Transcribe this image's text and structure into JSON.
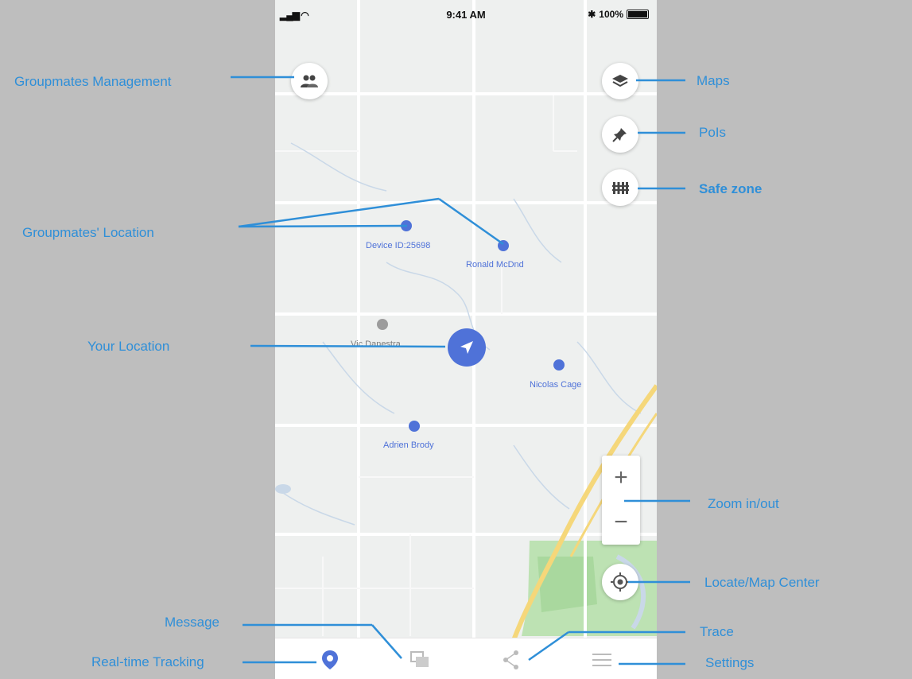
{
  "status_bar": {
    "time": "9:41 AM",
    "battery": "100%"
  },
  "annotations": {
    "groupmates_management": "Groupmates Management",
    "maps": "Maps",
    "pois": "PoIs",
    "safe_zone": "Safe zone",
    "groupmates_location": "Groupmates' Location",
    "your_location": "Your Location",
    "zoom": "Zoom in/out",
    "locate": "Locate/Map Center",
    "message": "Message",
    "trace": "Trace",
    "realtime": "Real-time Tracking",
    "settings": "Settings"
  },
  "markers": [
    {
      "label": "Device ID:25698"
    },
    {
      "label": "Ronald McDnd"
    },
    {
      "label": "Vic Danestra"
    },
    {
      "label": "Nicolas Cage"
    },
    {
      "label": "Adrien Brody"
    }
  ],
  "zoom": {
    "plus": "+",
    "minus": "−"
  },
  "icons": {
    "groupmates": "group-icon",
    "maps": "layers-icon",
    "pois": "pushpin-icon",
    "safe_zone": "fence-icon",
    "you": "navigation-arrow-icon",
    "locate": "crosshair-icon",
    "realtime": "location-pin-icon",
    "message": "chat-icon",
    "trace": "share-icon",
    "settings": "menu-icon"
  },
  "colors": {
    "accent": "#4f72d8",
    "annotation": "#2f8fd8",
    "background": "#bebebe"
  }
}
